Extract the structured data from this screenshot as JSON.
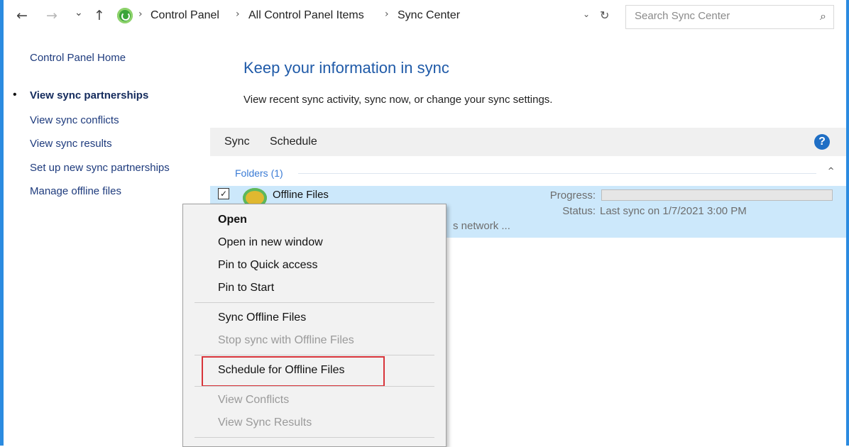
{
  "address_bar": {
    "back_icon": "←",
    "forward_icon": "→",
    "recent_icon": "⌄",
    "up_icon": "↑",
    "location_icon": "sync-center-icon",
    "breadcrumbs": [
      "Control Panel",
      "All Control Panel Items",
      "Sync Center"
    ],
    "separator": "›",
    "dropdown_icon": "⌄",
    "refresh_icon": "↻",
    "search_placeholder": "Search Sync Center",
    "search_icon": "⌕"
  },
  "sidebar": {
    "home": "Control Panel Home",
    "items": [
      {
        "label": "View sync partnerships",
        "active": true
      },
      {
        "label": "View sync conflicts",
        "active": false
      },
      {
        "label": "View sync results",
        "active": false
      },
      {
        "label": "Set up new sync partnerships",
        "active": false
      },
      {
        "label": "Manage offline files",
        "active": false
      }
    ],
    "bullet": "•"
  },
  "main": {
    "heading": "Keep your information in sync",
    "subheading": "View recent sync activity, sync now, or change your sync settings.",
    "toolbar": {
      "sync": "Sync",
      "schedule": "Schedule",
      "help_icon": "?"
    },
    "group": {
      "label": "Folders (1)",
      "collapse_icon": "^"
    },
    "item": {
      "checked": "✓",
      "name": "Offline Files",
      "progress_label": "Progress:",
      "progress_value": 0,
      "status_label": "Status:",
      "status_value": "Last sync on 1/7/2021 3:00 PM",
      "partial_text": "s network ..."
    }
  },
  "context_menu": {
    "items": [
      {
        "label": "Open",
        "style": "bold"
      },
      {
        "label": "Open in new window",
        "style": "normal"
      },
      {
        "label": "Pin to Quick access",
        "style": "normal"
      },
      {
        "label": "Pin to Start",
        "style": "normal"
      },
      {
        "label": "Sync Offline Files",
        "style": "normal"
      },
      {
        "label": "Stop sync with Offline Files",
        "style": "disabled"
      },
      {
        "label": "Schedule for Offline Files",
        "style": "highlighted"
      },
      {
        "label": "View Conflicts",
        "style": "disabled"
      },
      {
        "label": "View Sync Results",
        "style": "disabled"
      }
    ],
    "highlight_color": "#d8343a"
  },
  "colors": {
    "accent": "#2b8be0",
    "link": "#1e3b7d",
    "heading": "#1f5aa8",
    "selection": "#cce8fb"
  }
}
